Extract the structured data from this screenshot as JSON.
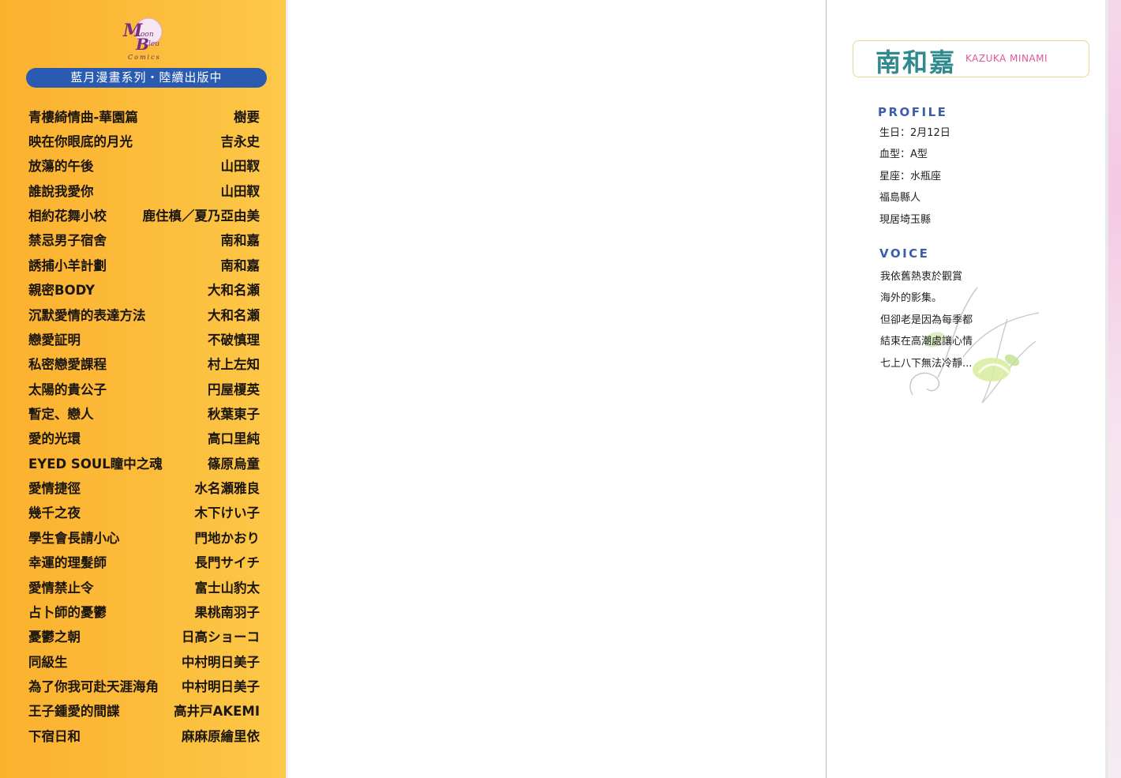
{
  "logo": {
    "mark_letters": [
      "M",
      "B"
    ],
    "word_1": "oon",
    "word_2": "leu",
    "word_3": "Comics"
  },
  "series_banner": "藍月漫畫系列・陸續出版中",
  "book_list": [
    {
      "title": "青樓綺情曲-華園篇",
      "author": "樹要"
    },
    {
      "title": "映在你眼底的月光",
      "author": "吉永史"
    },
    {
      "title": "放蕩的午後",
      "author": "山田靫"
    },
    {
      "title": "誰說我愛你",
      "author": "山田靫"
    },
    {
      "title": "相約花舞小校",
      "author": "鹿住槙／夏乃亞由美"
    },
    {
      "title": "禁忌男子宿舍",
      "author": "南和嘉"
    },
    {
      "title": "誘捕小羊計劃",
      "author": "南和嘉"
    },
    {
      "title": "親密BODY",
      "author": "大和名瀬"
    },
    {
      "title": "沉默愛情的表達方法",
      "author": "大和名瀬"
    },
    {
      "title": "戀愛証明",
      "author": "不破慎理"
    },
    {
      "title": "私密戀愛課程",
      "author": "村上左知"
    },
    {
      "title": "太陽的貴公子",
      "author": "円屋榎英"
    },
    {
      "title": "暫定、戀人",
      "author": "秋葉東子"
    },
    {
      "title": "愛的光環",
      "author": "高口里純"
    },
    {
      "title": "EYED SOUL瞳中之魂",
      "author": "篠原烏童"
    },
    {
      "title": "愛情捷徑",
      "author": "水名瀬雅良"
    },
    {
      "title": "幾千之夜",
      "author": "木下けい子"
    },
    {
      "title": "學生會長請小心",
      "author": "門地かおり"
    },
    {
      "title": "幸運的理髮師",
      "author": "長門サイチ"
    },
    {
      "title": "愛情禁止令",
      "author": "富士山豹太"
    },
    {
      "title": "占卜師的憂鬱",
      "author": "果桃南羽子"
    },
    {
      "title": "憂鬱之朝",
      "author": "日高ショーコ"
    },
    {
      "title": "同級生",
      "author": "中村明日美子"
    },
    {
      "title": "為了你我可赴天涯海角",
      "author": "中村明日美子"
    },
    {
      "title": "王子鍾愛的間諜",
      "author": "高井戸AKEMI"
    },
    {
      "title": "下宿日和",
      "author": "麻麻原繪里依"
    }
  ],
  "author_name": {
    "chinese": "南和嘉",
    "romaji": "KAZUKA MINAMI"
  },
  "profile": {
    "heading": "PROFILE",
    "items": [
      "生日：2月12日",
      "血型：A型",
      "星座：水瓶座",
      "福島縣人",
      "現居埼玉縣"
    ]
  },
  "voice": {
    "heading": "VOICE",
    "lines": [
      "我依舊熱衷於觀賞",
      "海外的影集。",
      "但卻老是因為每季都",
      "結束在高潮處讓心情",
      "七上八下無法冷靜..."
    ]
  },
  "colors": {
    "panel_orange": "#fcbd3c",
    "banner_blue": "#2a5bb0",
    "name_teal": "#2e8a8d",
    "romaji_pink": "#e0559a",
    "heading_blue": "#3c5ea8"
  },
  "icons": {
    "logo": "moon-bleu-comics-logo",
    "decoration": "leaf-swirl-decoration"
  }
}
